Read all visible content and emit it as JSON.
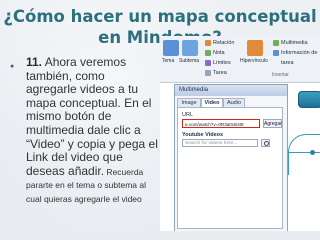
{
  "slide": {
    "title_line1": "¿Cómo hacer un mapa conceptual",
    "title_line2": "en Mindomo?",
    "step_number": "11.",
    "main_text": " Ahora veremos también, como agregarle videos a tu mapa conceptual. En el mismo botón de multimedia dale clic a “Video” y copia y pega el Link del video que deseas añadir.",
    "note_text": " Recuerda pararte en el tema o subtema al cual quieras agregarle el video"
  },
  "screenshot": {
    "ribbon": {
      "tema": "Tema",
      "subtema": "Subtema",
      "relacion": "Relación",
      "nota": "Nota",
      "tarea": "Tarea",
      "limites": "Límites",
      "multimedia": "Multimedia",
      "hipervinculo": "Hipervínculo",
      "informacion": "Información de tarea",
      "insertar": "Insertar"
    },
    "panel_title": "Multimedia",
    "tabs": [
      "Image",
      "Video",
      "Audio"
    ],
    "url_label": "URL",
    "url_value": "e.com/watch?v=0R3a0cB4I8",
    "add_button": "Agregar",
    "youtube_label": "Youtube Videos",
    "youtube_placeholder": "Search for videos here..."
  },
  "colors": {
    "title": "#2e6f7d",
    "bullet": "#35697b",
    "highlight": "#d9261c"
  }
}
